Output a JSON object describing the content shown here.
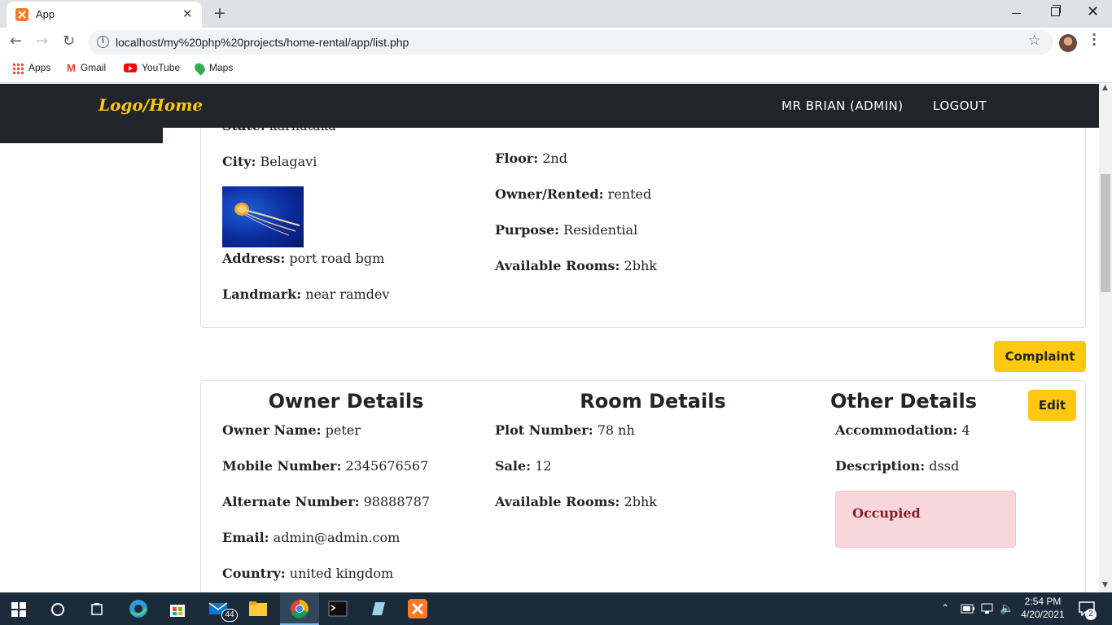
{
  "browser": {
    "tab_title": "App",
    "url": "localhost/my%20php%20projects/home-rental/app/list.php",
    "bookmarks": [
      "Apps",
      "Gmail",
      "YouTube",
      "Maps"
    ]
  },
  "navbar": {
    "brand": "Logo/Home",
    "user": "MR BRIAN (ADMIN)",
    "logout": "LOGOUT"
  },
  "card1": {
    "partial_label": "State:",
    "partial_value": "karnataka",
    "city": {
      "label": "City:",
      "value": "Belagavi"
    },
    "address": {
      "label": "Address:",
      "value": "port road bgm"
    },
    "landmark": {
      "label": "Landmark:",
      "value": "near ramdev"
    },
    "floor": {
      "label": "Floor:",
      "value": "2nd"
    },
    "owner_rented": {
      "label": "Owner/Rented:",
      "value": "rented"
    },
    "purpose": {
      "label": "Purpose:",
      "value": "Residential"
    },
    "rooms": {
      "label": "Available Rooms:",
      "value": "2bhk"
    }
  },
  "complaint_button": "Complaint",
  "card2": {
    "owner_heading": "Owner Details",
    "room_heading": "Room Details",
    "other_heading": "Other Details",
    "edit_button": "Edit",
    "owner_name": {
      "label": "Owner Name:",
      "value": "peter"
    },
    "mobile": {
      "label": "Mobile Number:",
      "value": "2345676567"
    },
    "alternate": {
      "label": "Alternate Number:",
      "value": "98888787"
    },
    "email": {
      "label": "Email:",
      "value": "admin@admin.com"
    },
    "country": {
      "label": "Country:",
      "value": "united kingdom"
    },
    "plot": {
      "label": "Plot Number:",
      "value": "78 nh"
    },
    "sale": {
      "label": "Sale:",
      "value": "12"
    },
    "rooms": {
      "label": "Available Rooms:",
      "value": "2bhk"
    },
    "accommodation": {
      "label": "Accommodation:",
      "value": "4"
    },
    "description": {
      "label": "Description:",
      "value": "dssd"
    },
    "status": "Occupied"
  },
  "taskbar": {
    "mail_badge": "44",
    "time": "2:54 PM",
    "date": "4/20/2021",
    "notification_count": "2"
  },
  "colors": {
    "navbar_bg": "#212529",
    "brand": "#fec810",
    "button_yellow": "#fec810",
    "occupied_bg": "#f8d7da",
    "occupied_text": "#842029"
  }
}
